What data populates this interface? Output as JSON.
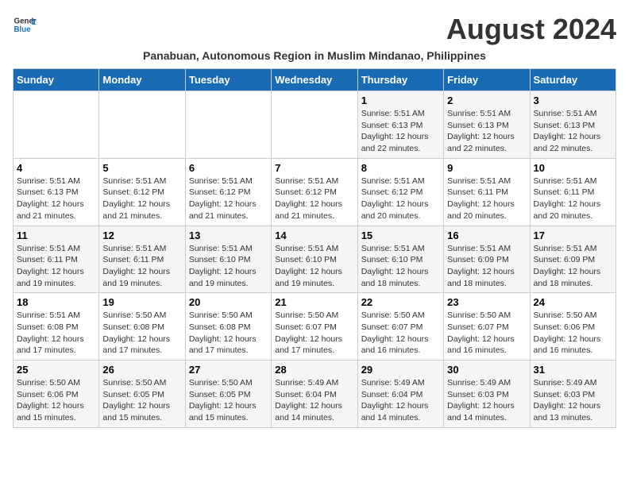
{
  "header": {
    "logo_general": "General",
    "logo_blue": "Blue",
    "month_title": "August 2024",
    "subtitle": "Panabuan, Autonomous Region in Muslim Mindanao, Philippines"
  },
  "days_of_week": [
    "Sunday",
    "Monday",
    "Tuesday",
    "Wednesday",
    "Thursday",
    "Friday",
    "Saturday"
  ],
  "weeks": [
    [
      {
        "day": "",
        "info": ""
      },
      {
        "day": "",
        "info": ""
      },
      {
        "day": "",
        "info": ""
      },
      {
        "day": "",
        "info": ""
      },
      {
        "day": "1",
        "info": "Sunrise: 5:51 AM\nSunset: 6:13 PM\nDaylight: 12 hours\nand 22 minutes."
      },
      {
        "day": "2",
        "info": "Sunrise: 5:51 AM\nSunset: 6:13 PM\nDaylight: 12 hours\nand 22 minutes."
      },
      {
        "day": "3",
        "info": "Sunrise: 5:51 AM\nSunset: 6:13 PM\nDaylight: 12 hours\nand 22 minutes."
      }
    ],
    [
      {
        "day": "4",
        "info": "Sunrise: 5:51 AM\nSunset: 6:13 PM\nDaylight: 12 hours\nand 21 minutes."
      },
      {
        "day": "5",
        "info": "Sunrise: 5:51 AM\nSunset: 6:12 PM\nDaylight: 12 hours\nand 21 minutes."
      },
      {
        "day": "6",
        "info": "Sunrise: 5:51 AM\nSunset: 6:12 PM\nDaylight: 12 hours\nand 21 minutes."
      },
      {
        "day": "7",
        "info": "Sunrise: 5:51 AM\nSunset: 6:12 PM\nDaylight: 12 hours\nand 21 minutes."
      },
      {
        "day": "8",
        "info": "Sunrise: 5:51 AM\nSunset: 6:12 PM\nDaylight: 12 hours\nand 20 minutes."
      },
      {
        "day": "9",
        "info": "Sunrise: 5:51 AM\nSunset: 6:11 PM\nDaylight: 12 hours\nand 20 minutes."
      },
      {
        "day": "10",
        "info": "Sunrise: 5:51 AM\nSunset: 6:11 PM\nDaylight: 12 hours\nand 20 minutes."
      }
    ],
    [
      {
        "day": "11",
        "info": "Sunrise: 5:51 AM\nSunset: 6:11 PM\nDaylight: 12 hours\nand 19 minutes."
      },
      {
        "day": "12",
        "info": "Sunrise: 5:51 AM\nSunset: 6:11 PM\nDaylight: 12 hours\nand 19 minutes."
      },
      {
        "day": "13",
        "info": "Sunrise: 5:51 AM\nSunset: 6:10 PM\nDaylight: 12 hours\nand 19 minutes."
      },
      {
        "day": "14",
        "info": "Sunrise: 5:51 AM\nSunset: 6:10 PM\nDaylight: 12 hours\nand 19 minutes."
      },
      {
        "day": "15",
        "info": "Sunrise: 5:51 AM\nSunset: 6:10 PM\nDaylight: 12 hours\nand 18 minutes."
      },
      {
        "day": "16",
        "info": "Sunrise: 5:51 AM\nSunset: 6:09 PM\nDaylight: 12 hours\nand 18 minutes."
      },
      {
        "day": "17",
        "info": "Sunrise: 5:51 AM\nSunset: 6:09 PM\nDaylight: 12 hours\nand 18 minutes."
      }
    ],
    [
      {
        "day": "18",
        "info": "Sunrise: 5:51 AM\nSunset: 6:08 PM\nDaylight: 12 hours\nand 17 minutes."
      },
      {
        "day": "19",
        "info": "Sunrise: 5:50 AM\nSunset: 6:08 PM\nDaylight: 12 hours\nand 17 minutes."
      },
      {
        "day": "20",
        "info": "Sunrise: 5:50 AM\nSunset: 6:08 PM\nDaylight: 12 hours\nand 17 minutes."
      },
      {
        "day": "21",
        "info": "Sunrise: 5:50 AM\nSunset: 6:07 PM\nDaylight: 12 hours\nand 17 minutes."
      },
      {
        "day": "22",
        "info": "Sunrise: 5:50 AM\nSunset: 6:07 PM\nDaylight: 12 hours\nand 16 minutes."
      },
      {
        "day": "23",
        "info": "Sunrise: 5:50 AM\nSunset: 6:07 PM\nDaylight: 12 hours\nand 16 minutes."
      },
      {
        "day": "24",
        "info": "Sunrise: 5:50 AM\nSunset: 6:06 PM\nDaylight: 12 hours\nand 16 minutes."
      }
    ],
    [
      {
        "day": "25",
        "info": "Sunrise: 5:50 AM\nSunset: 6:06 PM\nDaylight: 12 hours\nand 15 minutes."
      },
      {
        "day": "26",
        "info": "Sunrise: 5:50 AM\nSunset: 6:05 PM\nDaylight: 12 hours\nand 15 minutes."
      },
      {
        "day": "27",
        "info": "Sunrise: 5:50 AM\nSunset: 6:05 PM\nDaylight: 12 hours\nand 15 minutes."
      },
      {
        "day": "28",
        "info": "Sunrise: 5:49 AM\nSunset: 6:04 PM\nDaylight: 12 hours\nand 14 minutes."
      },
      {
        "day": "29",
        "info": "Sunrise: 5:49 AM\nSunset: 6:04 PM\nDaylight: 12 hours\nand 14 minutes."
      },
      {
        "day": "30",
        "info": "Sunrise: 5:49 AM\nSunset: 6:03 PM\nDaylight: 12 hours\nand 14 minutes."
      },
      {
        "day": "31",
        "info": "Sunrise: 5:49 AM\nSunset: 6:03 PM\nDaylight: 12 hours\nand 13 minutes."
      }
    ]
  ]
}
